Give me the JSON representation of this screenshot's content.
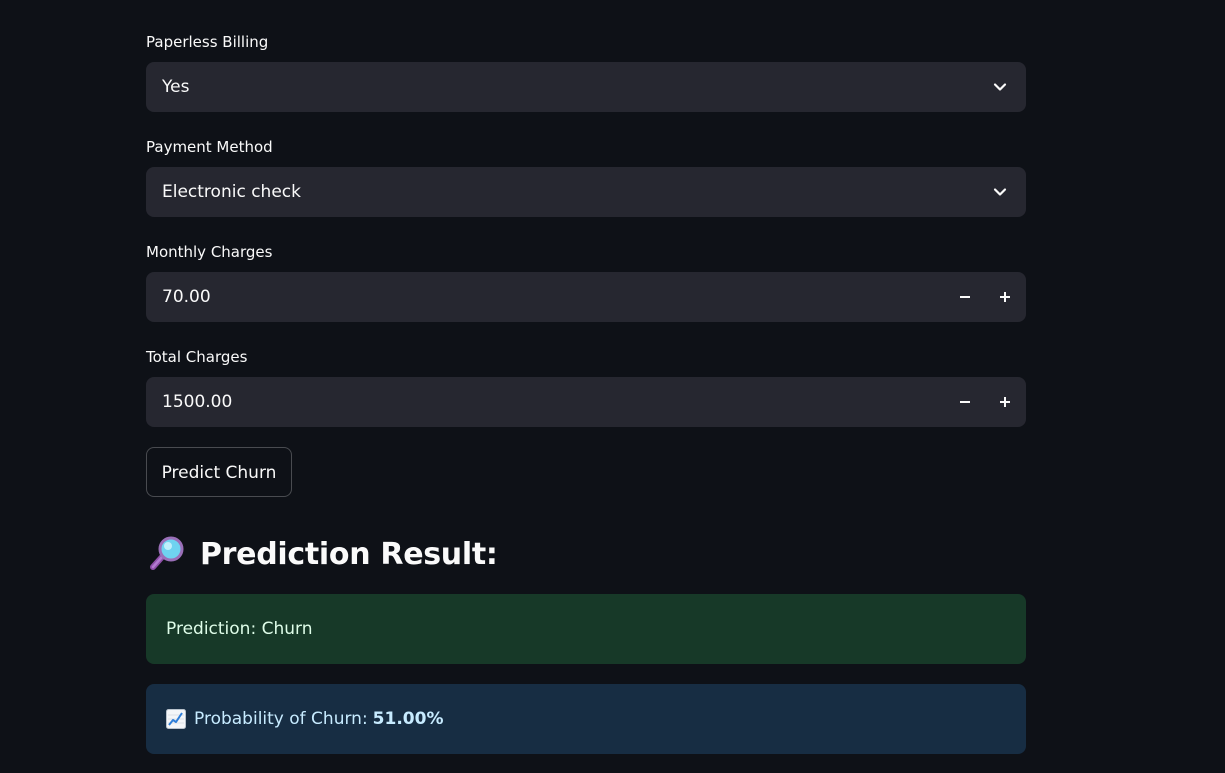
{
  "fields": {
    "paperless_billing": {
      "label": "Paperless Billing",
      "value": "Yes"
    },
    "payment_method": {
      "label": "Payment Method",
      "value": "Electronic check"
    },
    "monthly_charges": {
      "label": "Monthly Charges",
      "value": "70.00"
    },
    "total_charges": {
      "label": "Total Charges",
      "value": "1500.00"
    }
  },
  "predict_button": {
    "label": "Predict Churn"
  },
  "result": {
    "heading": "Prediction Result:",
    "heading_icon": "magnifying-glass-icon",
    "prediction_text": "Prediction: Churn",
    "probability_label": "Probability of Churn:",
    "probability_value": "51.00%",
    "probability_icon": "chart-increasing-icon"
  },
  "colors": {
    "background": "#0e1117",
    "control_bg": "#262730",
    "success_bg": "#173928",
    "success_text": "#dffde9",
    "info_bg": "#172d43",
    "info_text": "#c7ebff"
  }
}
